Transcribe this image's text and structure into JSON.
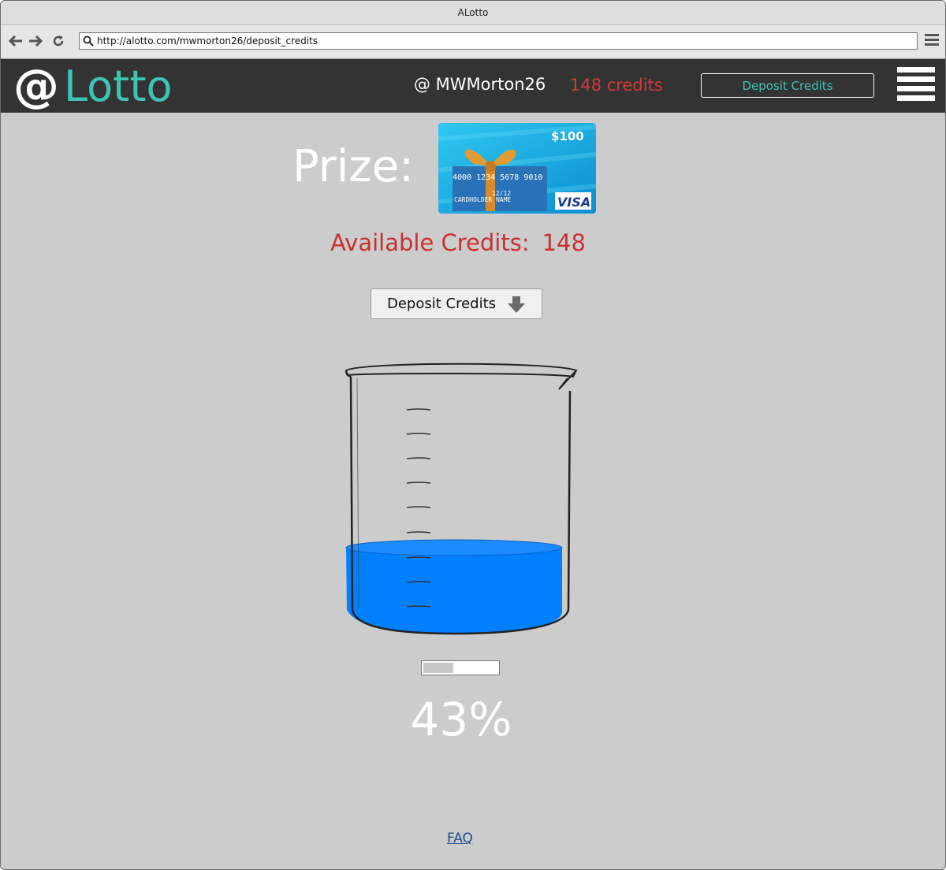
{
  "window": {
    "title": "ALotto"
  },
  "browser": {
    "url": "http://alotto.com/mwmorton26/deposit_credits"
  },
  "header": {
    "logo_at": "@",
    "logo_name": "Lotto",
    "username": "@ MWMorton26",
    "credits": "148 credits",
    "deposit_button": "Deposit Credits"
  },
  "prize": {
    "label": "Prize:",
    "card": {
      "amount": "$100",
      "number": "4000 1234 5678 9010",
      "expiry": "12/12",
      "holder": "CARDHOLDER NAME",
      "brand": "VISA"
    }
  },
  "available": {
    "label": "Available Credits:",
    "value": "148"
  },
  "deposit_button": {
    "label": "Deposit Credits",
    "icon": "arrow-down-icon"
  },
  "progress": {
    "fraction": 0.43,
    "percent_text": "43%"
  },
  "footer": {
    "faq_link": "FAQ"
  },
  "colors": {
    "header_bg": "#333333",
    "accent_teal": "#3cc4b4",
    "credits_red": "#d33a3a",
    "water_blue": "#0080ff",
    "page_bg": "#cccccc"
  }
}
